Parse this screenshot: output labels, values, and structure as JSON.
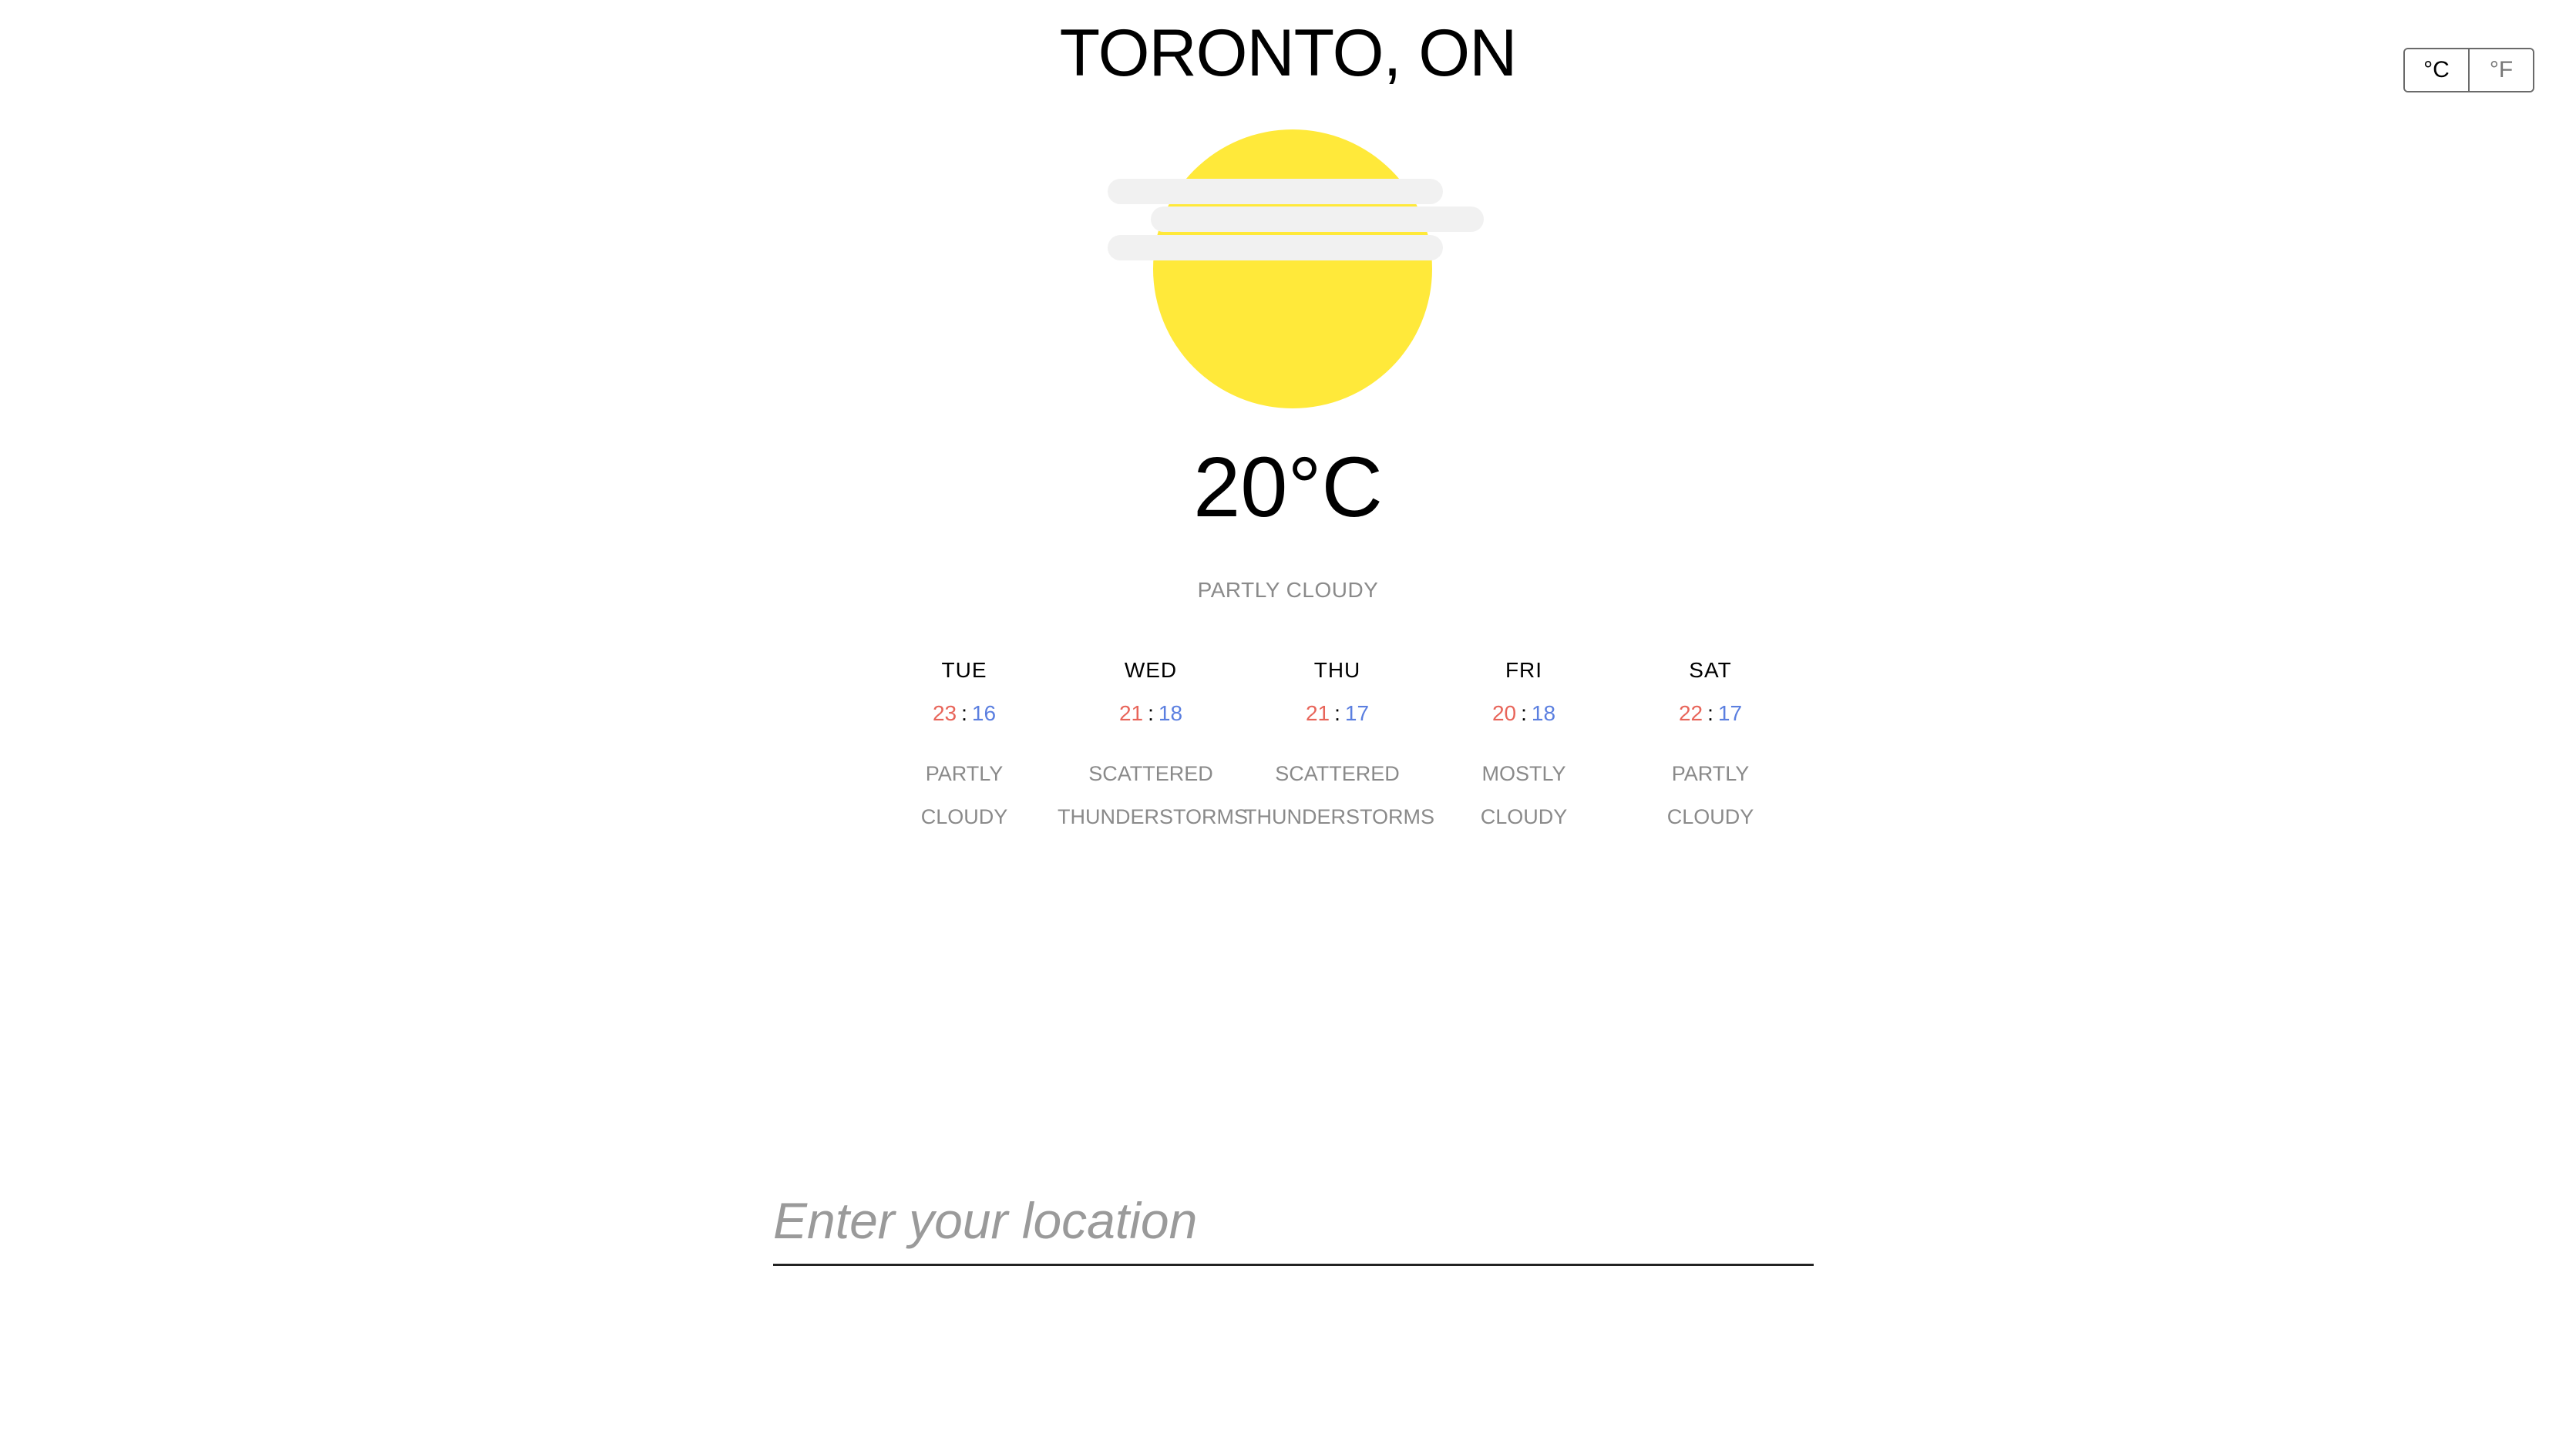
{
  "units": {
    "celsius_label": "°C",
    "fahrenheit_label": "°F",
    "selected": "celsius"
  },
  "location": {
    "city": "TORONTO, ON"
  },
  "current": {
    "temperature": "20°C",
    "condition": "PARTLY CLOUDY",
    "icon": "partly-cloudy-sun-icon"
  },
  "forecast": [
    {
      "day": "TUE",
      "high": "23",
      "low": "16",
      "condition_line1": "PARTLY",
      "condition_line2": "CLOUDY"
    },
    {
      "day": "WED",
      "high": "21",
      "low": "18",
      "condition_line1": "SCATTERED",
      "condition_line2": "THUNDERSTORMS"
    },
    {
      "day": "THU",
      "high": "21",
      "low": "17",
      "condition_line1": "SCATTERED",
      "condition_line2": "THUNDERSTORMS"
    },
    {
      "day": "FRI",
      "high": "20",
      "low": "18",
      "condition_line1": "MOSTLY",
      "condition_line2": "CLOUDY"
    },
    {
      "day": "SAT",
      "high": "22",
      "low": "17",
      "condition_line1": "PARTLY",
      "condition_line2": "CLOUDY"
    }
  ],
  "temp_separator": ":",
  "search": {
    "placeholder": "Enter your location",
    "value": ""
  },
  "colors": {
    "sun": "#FFE93A",
    "cloud": "#F1F1F1",
    "high_temp": "#E8655A",
    "low_temp": "#5B7FE0",
    "muted_text": "#8A8A8A"
  }
}
